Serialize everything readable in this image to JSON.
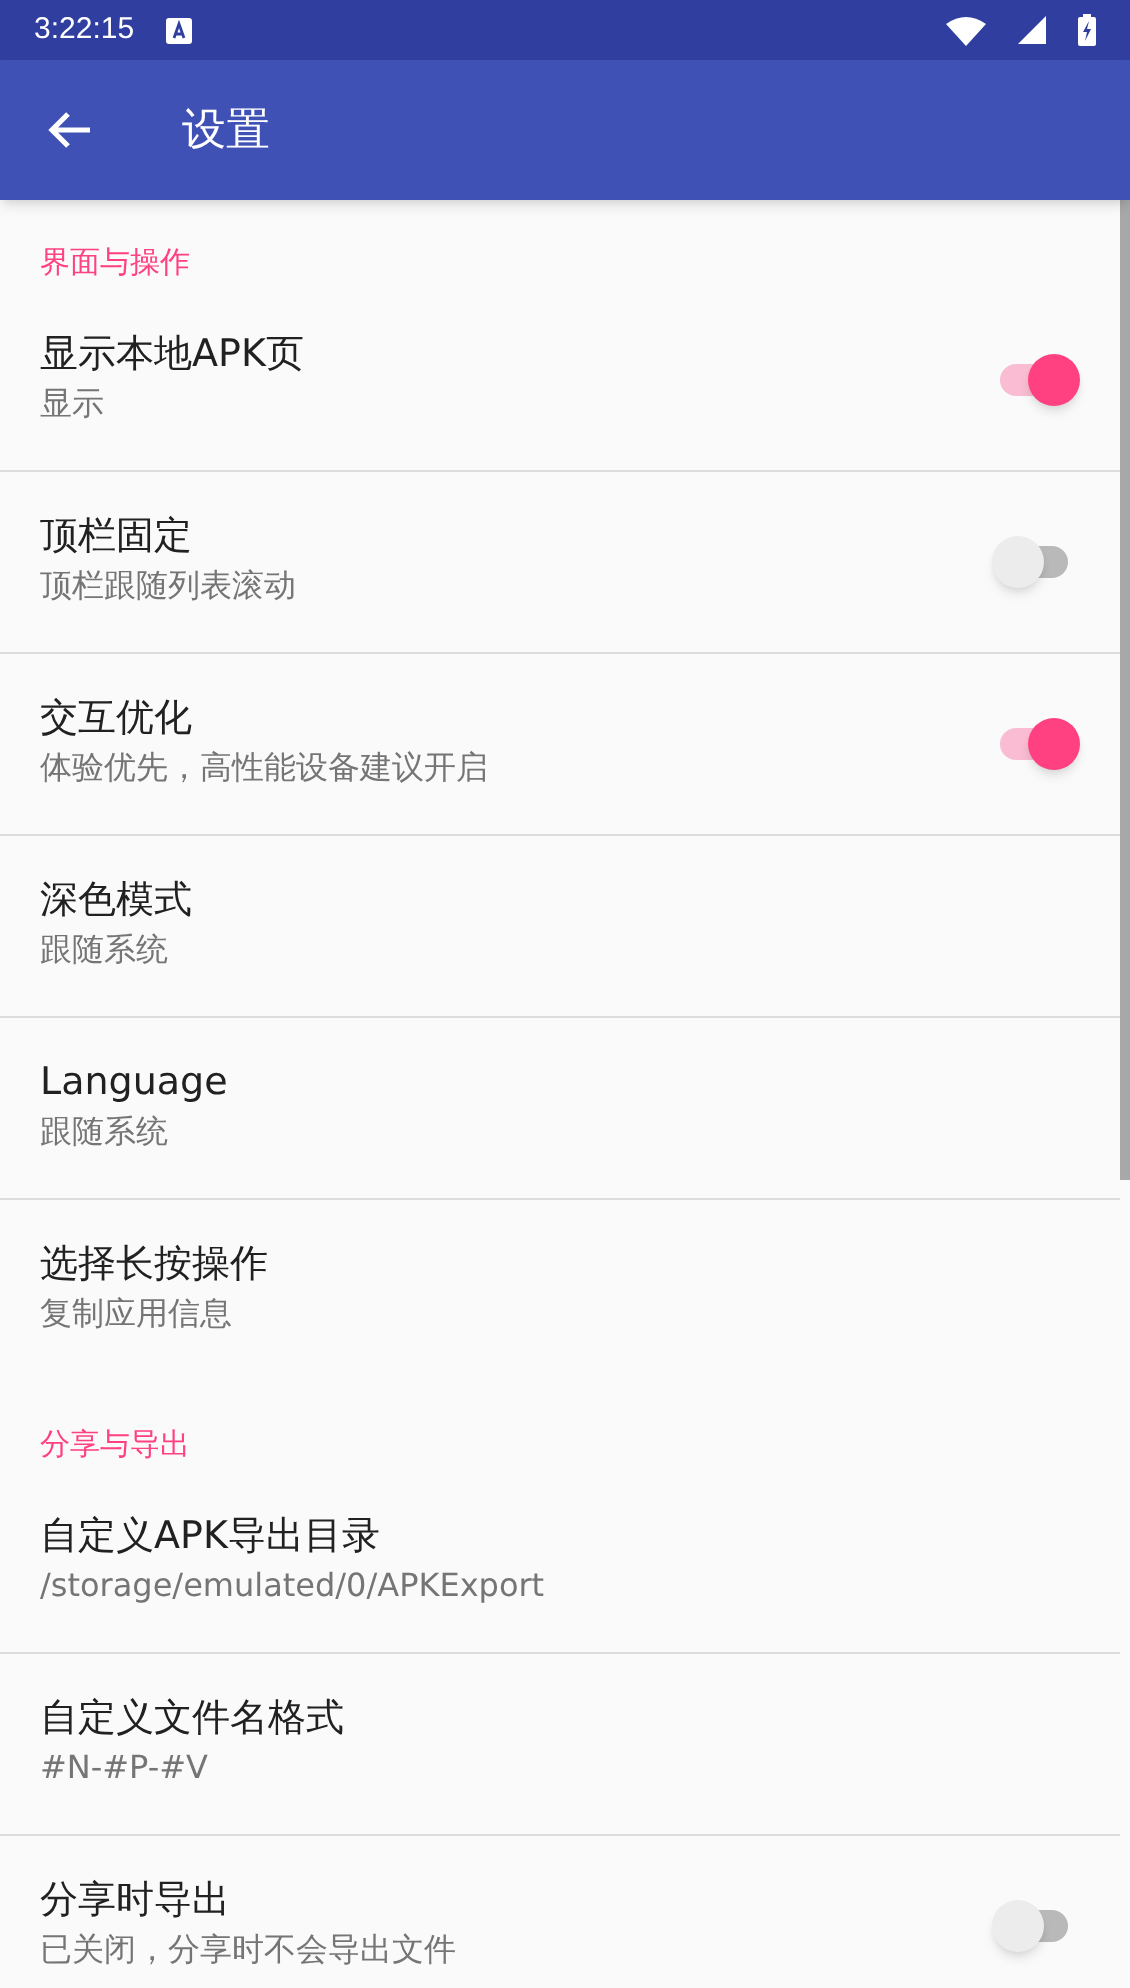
{
  "status_bar": {
    "time": "3:22:15"
  },
  "toolbar": {
    "title": "设置"
  },
  "sections": [
    {
      "header": "界面与操作",
      "items": [
        {
          "kind": "switch",
          "title": "显示本地APK页",
          "summary": "显示",
          "on": true
        },
        {
          "kind": "switch",
          "title": "顶栏固定",
          "summary": "顶栏跟随列表滚动",
          "on": false
        },
        {
          "kind": "switch",
          "title": "交互优化",
          "summary": "体验优先，高性能设备建议开启",
          "on": true
        },
        {
          "kind": "text",
          "title": "深色模式",
          "summary": "跟随系统"
        },
        {
          "kind": "text",
          "title": "Language",
          "summary": "跟随系统"
        },
        {
          "kind": "text",
          "title": "选择长按操作",
          "summary": "复制应用信息"
        }
      ]
    },
    {
      "header": "分享与导出",
      "items": [
        {
          "kind": "text",
          "title": "自定义APK导出目录",
          "summary": "/storage/emulated/0/APKExport"
        },
        {
          "kind": "text",
          "title": "自定义文件名格式",
          "summary": "#N-#P-#V"
        },
        {
          "kind": "switch",
          "title": "分享时导出",
          "summary": "已关闭，分享时不会导出文件",
          "on": false
        }
      ]
    }
  ]
}
